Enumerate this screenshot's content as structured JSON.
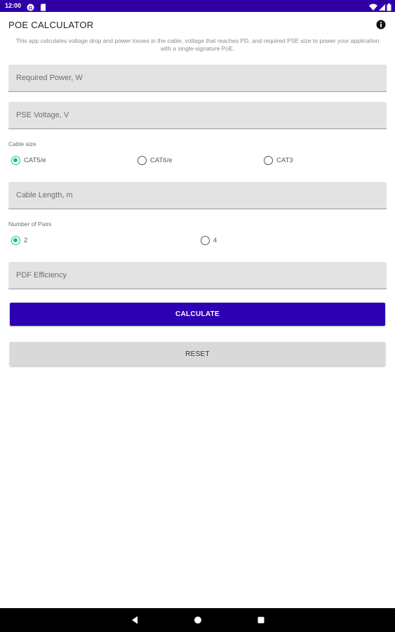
{
  "status_bar": {
    "time": "12:00",
    "color": "#2e00a6"
  },
  "header": {
    "title": "POE CALCULATOR",
    "description": "This app calculates voltage drop and power losses in the cable, voltage that reaches PD, and required PSE size to power your application with a single-signature PoE."
  },
  "fields": {
    "required_power": {
      "placeholder": "Required Power, W",
      "value": ""
    },
    "pse_voltage": {
      "placeholder": "PSE Voltage, V",
      "value": ""
    },
    "cable_length": {
      "placeholder": "Cable Length, m",
      "value": ""
    },
    "pdf_efficiency": {
      "placeholder": "PDF Efficiency",
      "value": ""
    }
  },
  "cable_size": {
    "label": "Cable size",
    "options": [
      "CAT5/e",
      "CAT6/e",
      "CAT3"
    ],
    "selected": "CAT5/e"
  },
  "pairs": {
    "label": "Number of Pairs",
    "options": [
      "2",
      "4"
    ],
    "selected": "2"
  },
  "buttons": {
    "calculate": "CALCULATE",
    "reset": "RESET"
  },
  "colors": {
    "accent": "#2e00b3",
    "radio_checked": "#1fb8a2"
  }
}
